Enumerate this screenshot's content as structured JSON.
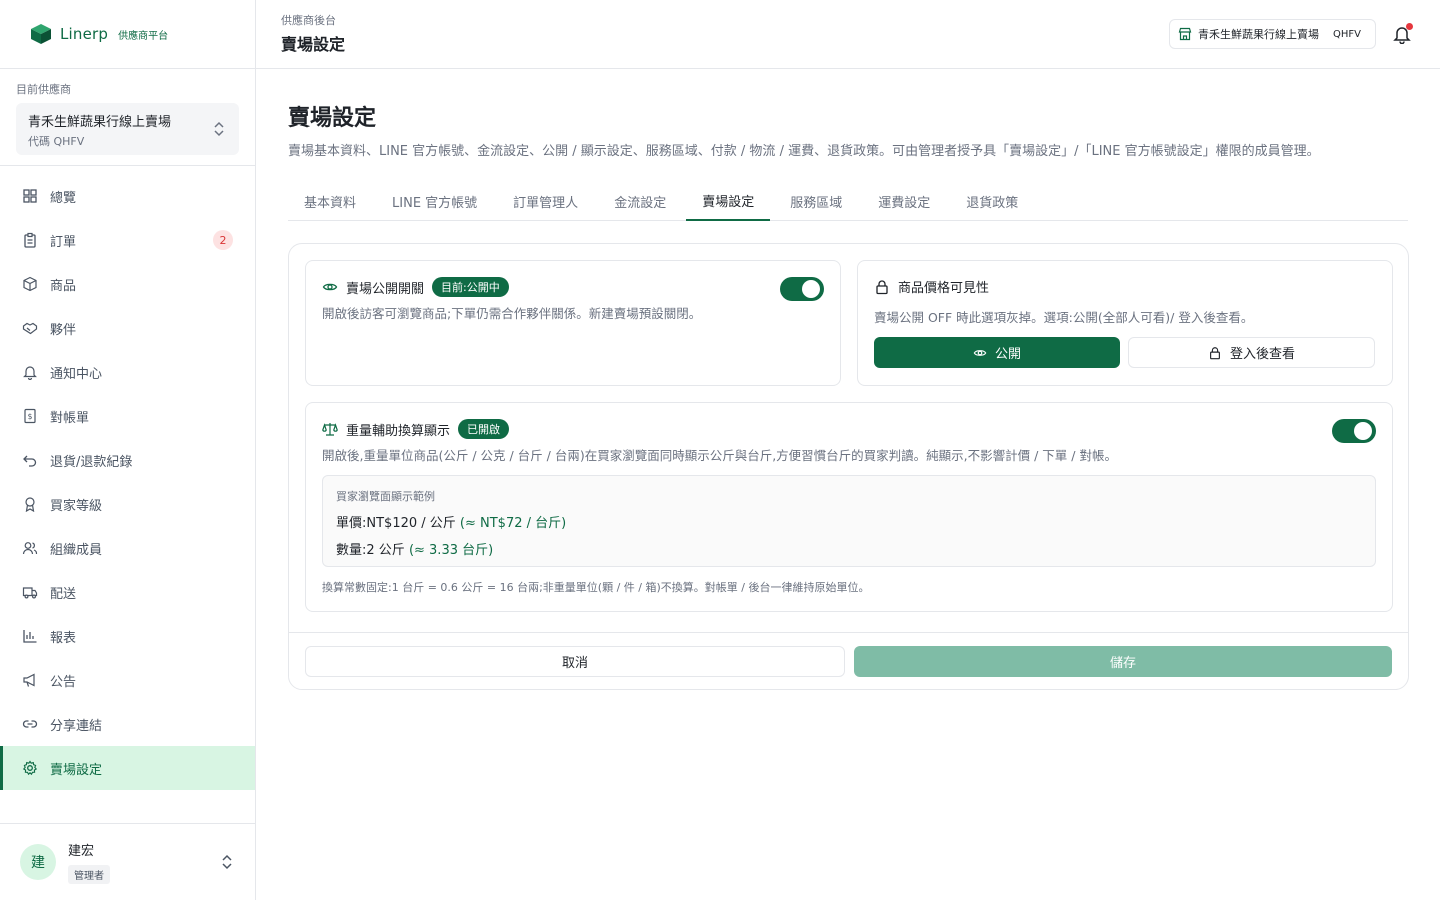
{
  "brand": {
    "name": "Linerp",
    "subtitle": "供應商平台"
  },
  "vendor": {
    "caption": "目前供應商",
    "name": "青禾生鮮蔬果行線上賣場",
    "code": "代碼 QHFV"
  },
  "nav": [
    {
      "label": "總覽",
      "icon": "dashboard-icon"
    },
    {
      "label": "訂單",
      "icon": "clipboard-icon",
      "badge": "2"
    },
    {
      "label": "商品",
      "icon": "box-icon"
    },
    {
      "label": "夥伴",
      "icon": "handshake-icon"
    },
    {
      "label": "通知中心",
      "icon": "bell-icon"
    },
    {
      "label": "對帳單",
      "icon": "receipt-icon"
    },
    {
      "label": "退貨/退款紀錄",
      "icon": "undo-icon"
    },
    {
      "label": "買家等級",
      "icon": "award-icon"
    },
    {
      "label": "組織成員",
      "icon": "users-icon"
    },
    {
      "label": "配送",
      "icon": "truck-icon"
    },
    {
      "label": "報表",
      "icon": "bar-chart-icon"
    },
    {
      "label": "公告",
      "icon": "megaphone-icon"
    },
    {
      "label": "分享連結",
      "icon": "link-icon"
    },
    {
      "label": "賣場設定",
      "icon": "gear-icon",
      "active": true
    }
  ],
  "user": {
    "initial": "建",
    "name": "建宏",
    "role": "管理者"
  },
  "header": {
    "breadcrumb": "供應商後台",
    "title": "賣場設定",
    "store_name": "青禾生鮮蔬果行線上賣場",
    "store_code": "QHFV"
  },
  "page": {
    "title": "賣場設定",
    "description": "賣場基本資料、LINE 官方帳號、金流設定、公開 / 顯示設定、服務區域、付款 / 物流 / 運費、退貨政策。可由管理者授予具「賣場設定」/「LINE 官方帳號設定」權限的成員管理。"
  },
  "tabs": [
    "基本資料",
    "LINE 官方帳號",
    "訂單管理人",
    "金流設定",
    "賣場設定",
    "服務區域",
    "運費設定",
    "退貨政策"
  ],
  "active_tab": "賣場設定",
  "public_switch": {
    "title": "賣場公開開關",
    "status": "目前:公開中",
    "description": "開啟後訪客可瀏覽商品;下單仍需合作夥伴關係。新建賣場預設關閉。",
    "enabled": true
  },
  "price_visibility": {
    "title": "商品價格可見性",
    "description": "賣場公開 OFF 時此選項灰掉。選項:公開(全部人可看)/ 登入後查看。",
    "option_public": "公開",
    "option_login": "登入後查看",
    "selected": "公開"
  },
  "weight_conversion": {
    "title": "重量輔助換算顯示",
    "status": "已開啟",
    "description": "開啟後,重量單位商品(公斤 / 公克 / 台斤 / 台兩)在買家瀏覽面同時顯示公斤與台斤,方便習慣台斤的買家判讀。純顯示,不影響計價 / 下單 / 對帳。",
    "enabled": true,
    "example_caption": "買家瀏覽面顯示範例",
    "example_price_main": "單價:NT$120 / 公斤",
    "example_price_alt": "(≈ NT$72 / 台斤)",
    "example_qty_main": "數量:2 公斤",
    "example_qty_alt": "(≈ 3.33 台斤)",
    "note": "換算常數固定:1 台斤 = 0.6 公斤 = 16 台兩;非重量單位(顆 / 件 / 箱)不換算。對帳單 / 後台一律維持原始單位。"
  },
  "actions": {
    "cancel": "取消",
    "save": "儲存"
  },
  "colors": {
    "primary": "#0f6b45",
    "active_bg": "#d8f5e3",
    "save_disabled": "#7fbca6",
    "badge_bg": "#fde2e2",
    "badge_text": "#d93636"
  }
}
